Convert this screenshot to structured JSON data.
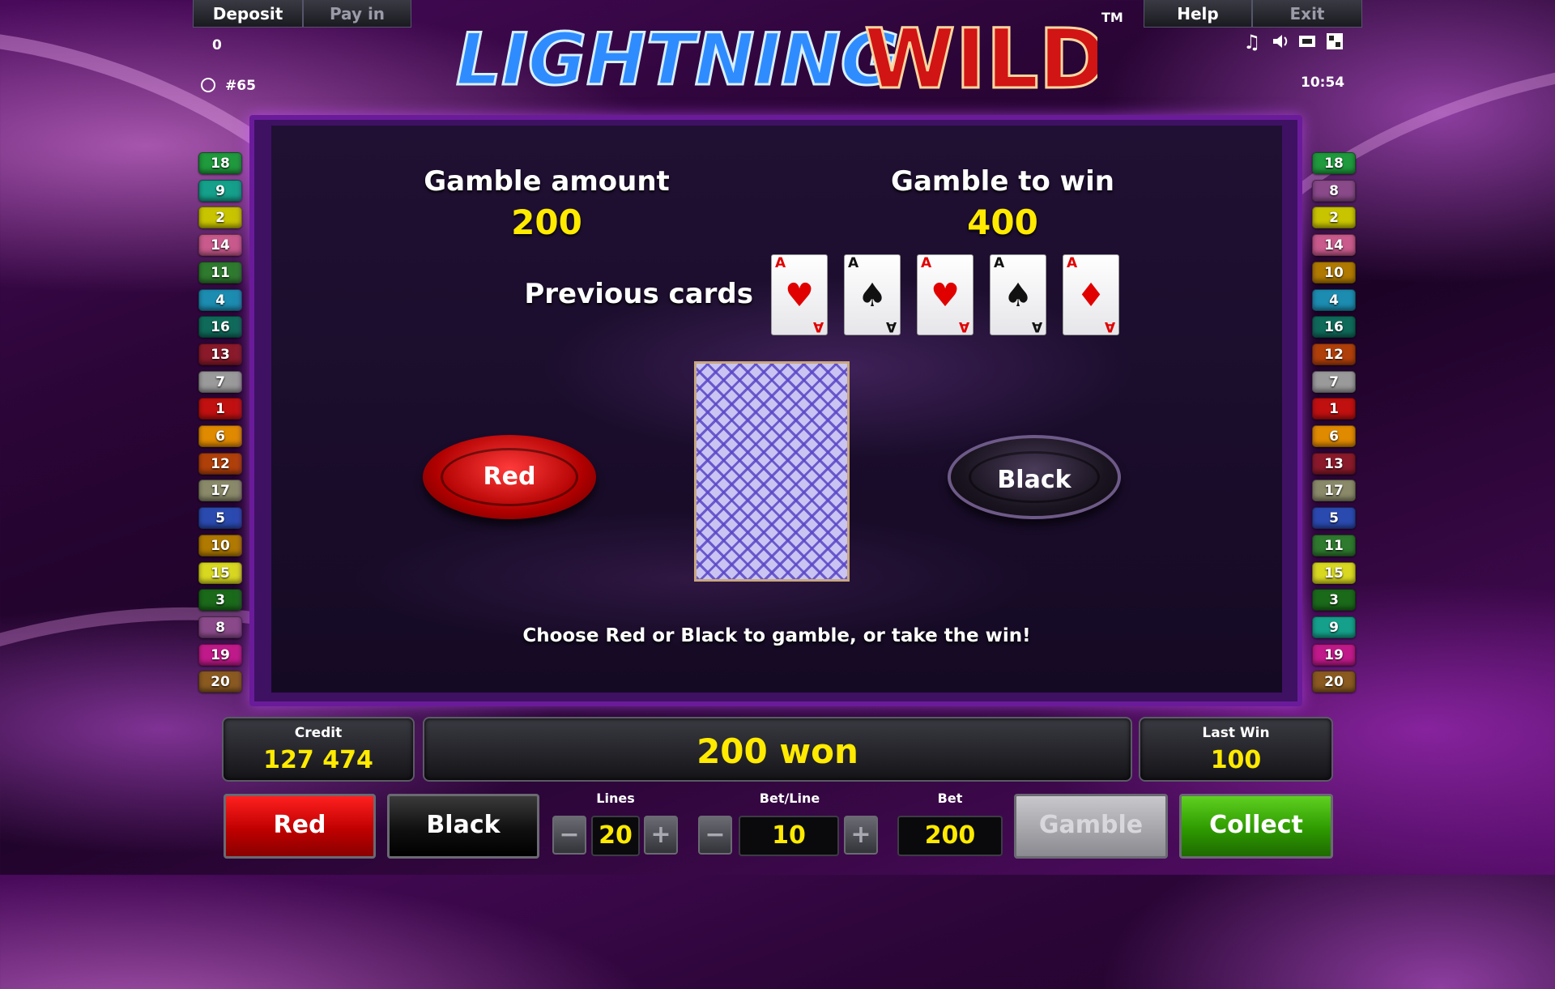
{
  "top_bar": {
    "deposit": "Deposit",
    "pay_in": "Pay in",
    "help": "Help",
    "exit": "Exit"
  },
  "info": {
    "deposit_value": "0",
    "round_id": "#65",
    "clock": "10:54",
    "trademark": "TM"
  },
  "logo": {
    "word1": "LIGHTNING",
    "word2": "WILD"
  },
  "paylines_left": [
    {
      "n": "18",
      "color": "#1f9a3c"
    },
    {
      "n": "9",
      "color": "#14a08a"
    },
    {
      "n": "2",
      "color": "#c8c400"
    },
    {
      "n": "14",
      "color": "#c85a8c"
    },
    {
      "n": "11",
      "color": "#2e7a2e"
    },
    {
      "n": "4",
      "color": "#1c8cb0"
    },
    {
      "n": "16",
      "color": "#0f6a5a"
    },
    {
      "n": "13",
      "color": "#8a1a2a"
    },
    {
      "n": "7",
      "color": "#9a9a9a"
    },
    {
      "n": "1",
      "color": "#c01010"
    },
    {
      "n": "6",
      "color": "#e08a00"
    },
    {
      "n": "12",
      "color": "#b0400a"
    },
    {
      "n": "17",
      "color": "#8a8a6a"
    },
    {
      "n": "5",
      "color": "#2a4ab0"
    },
    {
      "n": "10",
      "color": "#b07a00"
    },
    {
      "n": "15",
      "color": "#d8d820"
    },
    {
      "n": "3",
      "color": "#1a6a1a"
    },
    {
      "n": "8",
      "color": "#8a4a8a"
    },
    {
      "n": "19",
      "color": "#c01a8a"
    },
    {
      "n": "20",
      "color": "#8a5a20"
    }
  ],
  "paylines_right": [
    {
      "n": "18",
      "color": "#1f9a3c"
    },
    {
      "n": "8",
      "color": "#8a4a8a"
    },
    {
      "n": "2",
      "color": "#c8c400"
    },
    {
      "n": "14",
      "color": "#c85a8c"
    },
    {
      "n": "10",
      "color": "#b07a00"
    },
    {
      "n": "4",
      "color": "#1c8cb0"
    },
    {
      "n": "16",
      "color": "#0f6a5a"
    },
    {
      "n": "12",
      "color": "#b0400a"
    },
    {
      "n": "7",
      "color": "#9a9a9a"
    },
    {
      "n": "1",
      "color": "#c01010"
    },
    {
      "n": "6",
      "color": "#e08a00"
    },
    {
      "n": "13",
      "color": "#8a1a2a"
    },
    {
      "n": "17",
      "color": "#8a8a6a"
    },
    {
      "n": "5",
      "color": "#2a4ab0"
    },
    {
      "n": "11",
      "color": "#2e7a2e"
    },
    {
      "n": "15",
      "color": "#d8d820"
    },
    {
      "n": "3",
      "color": "#1a6a1a"
    },
    {
      "n": "9",
      "color": "#14a08a"
    },
    {
      "n": "19",
      "color": "#c01a8a"
    },
    {
      "n": "20",
      "color": "#8a5a20"
    }
  ],
  "gamble": {
    "amount_label": "Gamble amount",
    "amount": "200",
    "to_win_label": "Gamble to win",
    "to_win": "400",
    "previous_cards_label": "Previous cards",
    "previous_cards": [
      {
        "rank": "A",
        "suit": "hearts",
        "symbol": "♥",
        "color": "red"
      },
      {
        "rank": "A",
        "suit": "spades",
        "symbol": "♠",
        "color": "black"
      },
      {
        "rank": "A",
        "suit": "hearts",
        "symbol": "♥",
        "color": "red"
      },
      {
        "rank": "A",
        "suit": "spades",
        "symbol": "♠",
        "color": "black"
      },
      {
        "rank": "A",
        "suit": "diamonds",
        "symbol": "♦",
        "color": "red"
      }
    ],
    "red_button": "Red",
    "black_button": "Black",
    "instruction": "Choose Red or Black to gamble, or take the win!"
  },
  "status": {
    "credit_label": "Credit",
    "credit": "127 474",
    "message": "200 won",
    "last_win_label": "Last Win",
    "last_win": "100"
  },
  "controls": {
    "red": "Red",
    "black": "Black",
    "lines_label": "Lines",
    "lines": "20",
    "bet_line_label": "Bet/Line",
    "bet_line": "10",
    "bet_label": "Bet",
    "bet": "200",
    "minus": "−",
    "plus": "+",
    "gamble": "Gamble",
    "collect": "Collect"
  },
  "colors": {
    "accent_yellow": "#ffea00",
    "red_button": "#d60000",
    "collect_green": "#3aa000",
    "panel_border": "#6a1b9a"
  }
}
